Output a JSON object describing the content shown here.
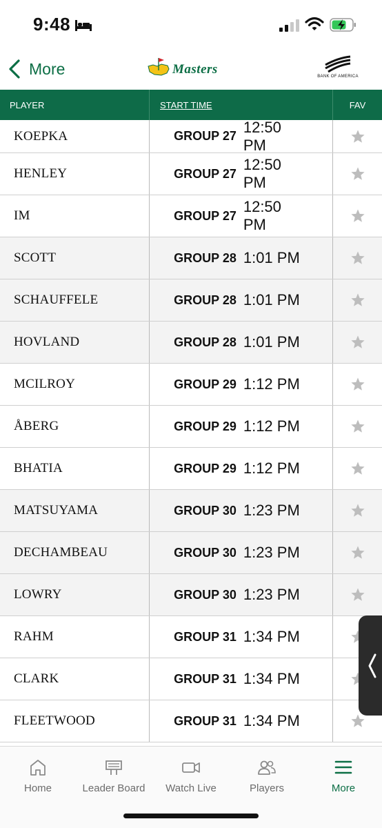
{
  "status_bar": {
    "time": "9:48"
  },
  "header": {
    "back_label": "More",
    "logo_text": "Masters",
    "sponsor_text": "BANK OF AMERICA"
  },
  "table": {
    "columns": {
      "player": "PLAYER",
      "start_time": "START TIME",
      "fav": "FAV"
    },
    "rows": [
      {
        "player": "KOEPKA",
        "group": "GROUP 27",
        "time": "12:50 PM"
      },
      {
        "player": "HENLEY",
        "group": "GROUP 27",
        "time": "12:50 PM"
      },
      {
        "player": "IM",
        "group": "GROUP 27",
        "time": "12:50 PM"
      },
      {
        "player": "SCOTT",
        "group": "GROUP 28",
        "time": "1:01 PM"
      },
      {
        "player": "SCHAUFFELE",
        "group": "GROUP 28",
        "time": "1:01 PM"
      },
      {
        "player": "HOVLAND",
        "group": "GROUP 28",
        "time": "1:01 PM"
      },
      {
        "player": "MCILROY",
        "group": "GROUP 29",
        "time": "1:12 PM"
      },
      {
        "player": "ÅBERG",
        "group": "GROUP 29",
        "time": "1:12 PM"
      },
      {
        "player": "BHATIA",
        "group": "GROUP 29",
        "time": "1:12 PM"
      },
      {
        "player": "MATSUYAMA",
        "group": "GROUP 30",
        "time": "1:23 PM"
      },
      {
        "player": "DECHAMBEAU",
        "group": "GROUP 30",
        "time": "1:23 PM"
      },
      {
        "player": "LOWRY",
        "group": "GROUP 30",
        "time": "1:23 PM"
      },
      {
        "player": "RAHM",
        "group": "GROUP 31",
        "time": "1:34 PM"
      },
      {
        "player": "CLARK",
        "group": "GROUP 31",
        "time": "1:34 PM"
      },
      {
        "player": "FLEETWOOD",
        "group": "GROUP 31",
        "time": "1:34 PM"
      }
    ]
  },
  "bottom_nav": {
    "items": [
      {
        "label": "Home",
        "icon": "home-icon"
      },
      {
        "label": "Leader Board",
        "icon": "leaderboard-icon"
      },
      {
        "label": "Watch Live",
        "icon": "video-camera-icon"
      },
      {
        "label": "Players",
        "icon": "players-icon"
      },
      {
        "label": "More",
        "icon": "menu-icon",
        "active": true
      }
    ]
  },
  "colors": {
    "brand_green": "#0e6b48",
    "star_gray": "#bdbdbd",
    "row_shade": "#f3f3f3"
  }
}
